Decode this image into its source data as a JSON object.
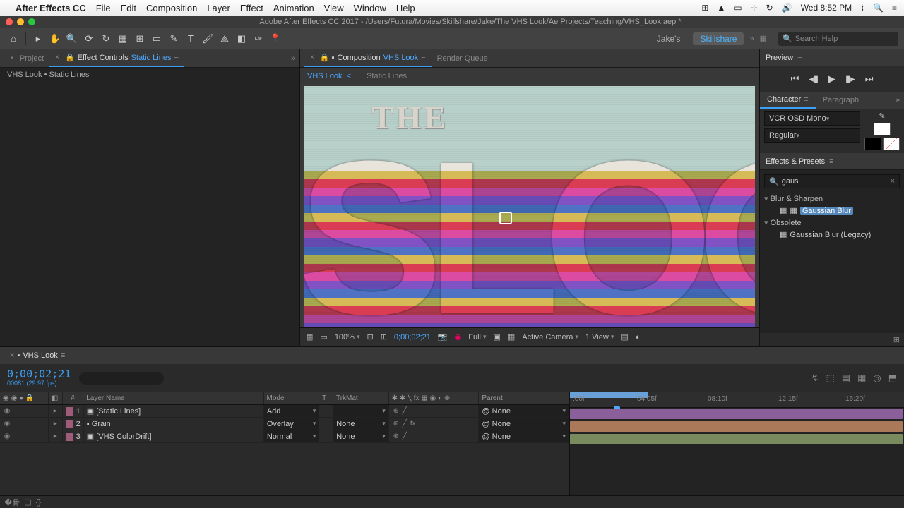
{
  "mac_menu": {
    "app": "After Effects CC",
    "items": [
      "File",
      "Edit",
      "Composition",
      "Layer",
      "Effect",
      "Animation",
      "View",
      "Window",
      "Help"
    ],
    "clock": "Wed 8:52 PM"
  },
  "title_bar": "Adobe After Effects CC 2017 - /Users/Futura/Movies/Skillshare/Jake/The VHS Look/Ae Projects/Teaching/VHS_Look.aep *",
  "workspace": {
    "left": "Jake's",
    "active": "Skillshare",
    "search_placeholder": "Search Help"
  },
  "project": {
    "tab1": "Project",
    "tab2_prefix": "Effect Controls ",
    "tab2_comp": "Static Lines",
    "breadcrumb": "VHS Look • Static Lines"
  },
  "composition": {
    "tab_prefix": "Composition ",
    "tab_name": "VHS Look",
    "render_queue": "Render Queue",
    "crumb_active": "VHS Look",
    "crumb_next": "Static Lines"
  },
  "viewer_footer": {
    "zoom": "100%",
    "time": "0;00;02;21",
    "res": "Full",
    "camera": "Active Camera",
    "views": "1 View"
  },
  "preview_panel": "Preview",
  "character": {
    "tab1": "Character",
    "tab2": "Paragraph",
    "font": "VCR OSD Mono",
    "style": "Regular"
  },
  "effects": {
    "title": "Effects & Presets",
    "search": "gaus",
    "folder1": "Blur & Sharpen",
    "item1": "Gaussian Blur",
    "folder2": "Obsolete",
    "item2": "Gaussian Blur (Legacy)"
  },
  "timeline": {
    "tab": "VHS Look",
    "timecode": "0;00;02;21",
    "timecode_sub": "00081 (29.97 fps)",
    "cols": {
      "layer_name": "Layer Name",
      "mode": "Mode",
      "t": "T",
      "trkmat": "TrkMat",
      "parent": "Parent",
      "num": "#"
    },
    "ticks": [
      ":00f",
      "04:05f",
      "08:10f",
      "12:15f",
      "16:20f"
    ],
    "layers": [
      {
        "num": "1",
        "name": "[Static Lines]",
        "mode": "Add",
        "trkmat": "",
        "parent": "None"
      },
      {
        "num": "2",
        "name": "Grain",
        "mode": "Overlay",
        "trkmat": "None",
        "parent": "None"
      },
      {
        "num": "3",
        "name": "[VHS ColorDrift]",
        "mode": "Normal",
        "trkmat": "None",
        "parent": "None"
      }
    ]
  },
  "canvas_text": {
    "the": "THE",
    "look": "SLOOK"
  }
}
